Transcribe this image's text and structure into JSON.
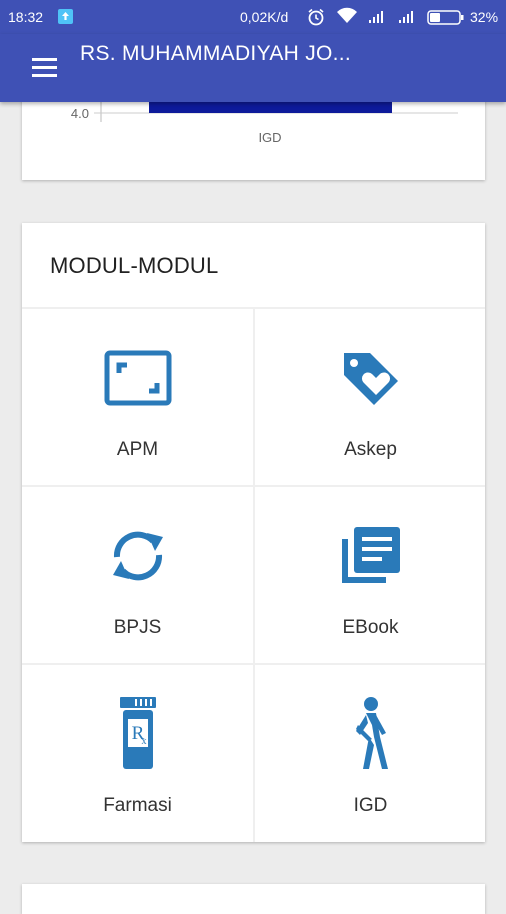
{
  "status_bar": {
    "time": "18:32",
    "network_speed": "0,02K/d",
    "battery_percent": "32%"
  },
  "app_bar": {
    "title": "RS. MUHAMMADIYAH JO..."
  },
  "chart_data": {
    "type": "bar",
    "categories": [
      "IGD"
    ],
    "y_tick_visible": "4.0",
    "bar_color": "#0d1a9a"
  },
  "modules": {
    "title": "MODUL-MODUL",
    "accent_color": "#2a7ab9",
    "items": [
      {
        "label": "APM",
        "icon": "screen-frame-icon"
      },
      {
        "label": "Askep",
        "icon": "heart-tag-icon"
      },
      {
        "label": "BPJS",
        "icon": "sync-icon"
      },
      {
        "label": "EBook",
        "icon": "library-books-icon"
      },
      {
        "label": "Farmasi",
        "icon": "prescription-bottle-icon"
      },
      {
        "label": "IGD",
        "icon": "injured-walker-icon"
      }
    ]
  }
}
